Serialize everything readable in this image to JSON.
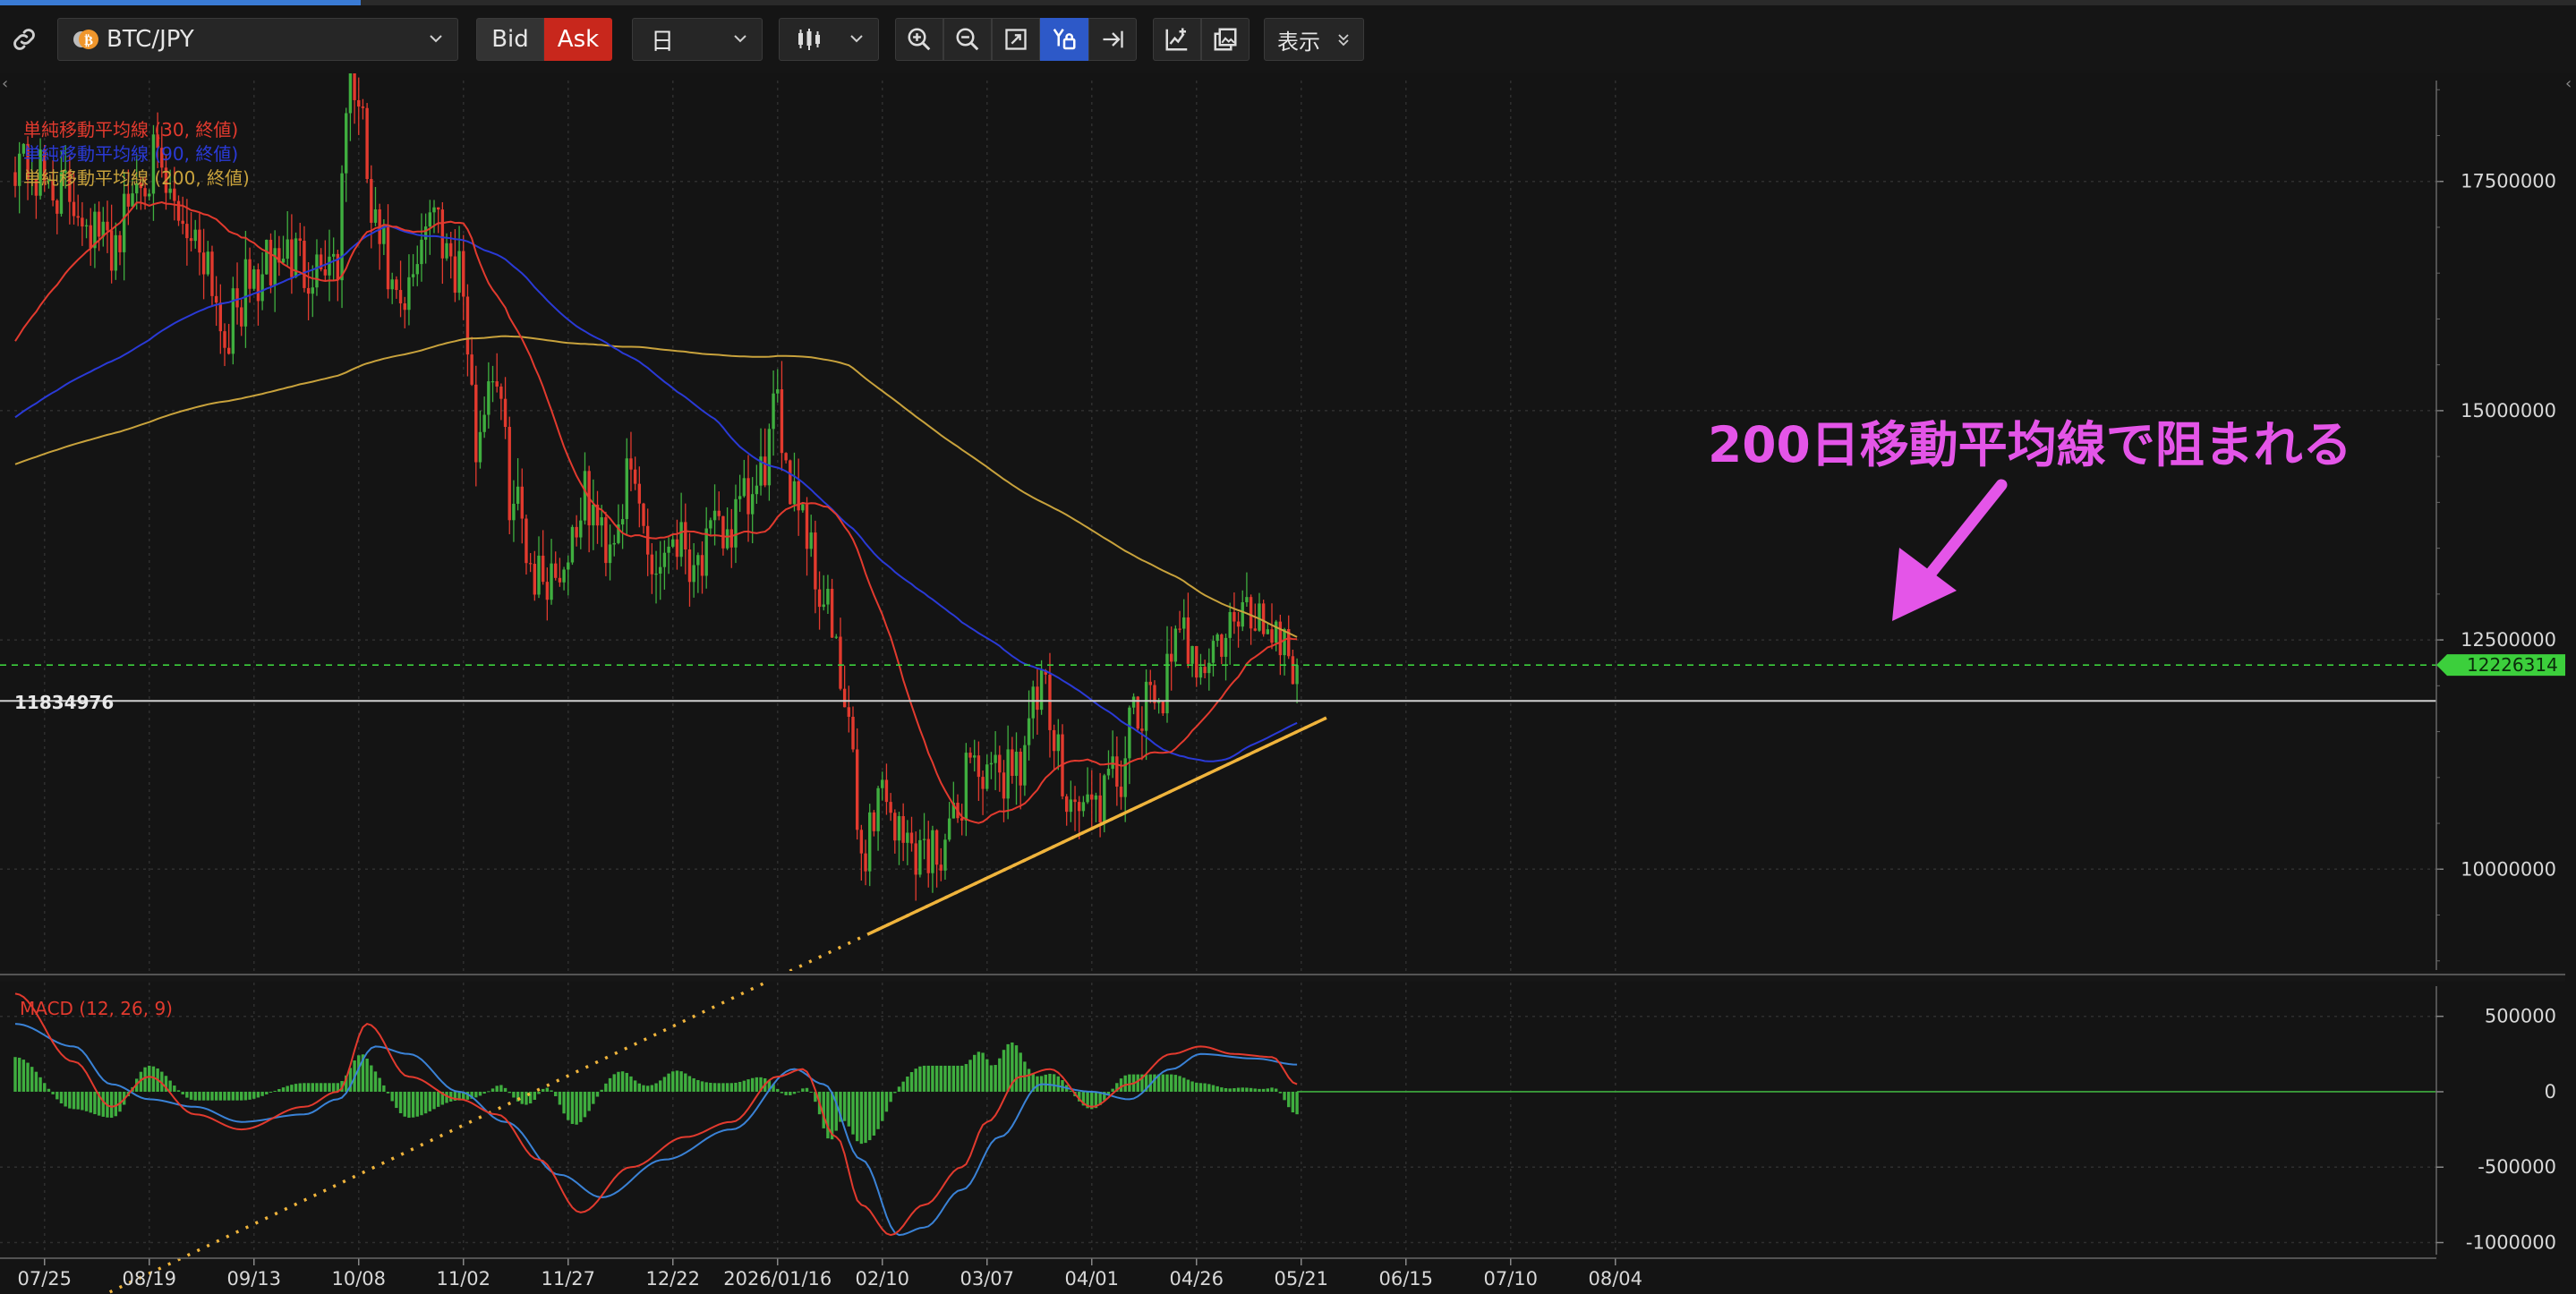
{
  "toolbar": {
    "symbol": "BTC/JPY",
    "bid_label": "Bid",
    "ask_label": "Ask",
    "timeframe": "日",
    "display_label": "表示",
    "page_load_progress": 0.14
  },
  "colors": {
    "background": "#141414",
    "candle_up": "#3fae3f",
    "candle_down": "#e23a2e",
    "sma30": "#e23a2e",
    "sma90": "#2a3ad6",
    "sma200": "#c8a23c",
    "trendline": "#f0b43c",
    "annotation": "#e455e8",
    "current_price_line": "#3ccf3c",
    "ask_active": "#c8271c",
    "tool_active": "#2d59c8"
  },
  "chart_data": {
    "type": "candlestick",
    "price_pane": {
      "y_ticks": [
        10000000,
        12500000,
        15000000,
        17500000
      ],
      "ylim": [
        8900000,
        18600000
      ],
      "legend": [
        {
          "label": "単純移動平均線 (30, 終値)",
          "color": "#e23a2e"
        },
        {
          "label": "単純移動平均線 (90, 終値)",
          "color": "#2a3ad6"
        },
        {
          "label": "単純移動平均線 (200, 終値)",
          "color": "#c8a23c"
        }
      ],
      "horizontal_line_label": "11834976",
      "horizontal_line_value": 11834976,
      "current_price_label": "12226314",
      "current_price_value": 12226314,
      "annotation": "200日移動平均線で阻まれる",
      "trendline": {
        "start_date": "02/07",
        "start_value": 9300000,
        "end_date": "05/27",
        "end_value": 11650000,
        "extend_to": "08/08"
      },
      "anchors": [
        [
          "07/18",
          17800000
        ],
        [
          "07/25",
          17500000
        ],
        [
          "08/01",
          17300000
        ],
        [
          "08/09",
          16800000
        ],
        [
          "08/19",
          17700000
        ],
        [
          "08/25",
          17200000
        ],
        [
          "09/01",
          16800000
        ],
        [
          "09/06",
          15900000
        ],
        [
          "09/13",
          16400000
        ],
        [
          "09/20",
          16700000
        ],
        [
          "09/27",
          16600000
        ],
        [
          "10/03",
          16700000
        ],
        [
          "10/06",
          18900000
        ],
        [
          "10/08",
          18200000
        ],
        [
          "10/12",
          16900000
        ],
        [
          "10/18",
          16000000
        ],
        [
          "10/25",
          17200000
        ],
        [
          "11/01",
          16600000
        ],
        [
          "11/05",
          14700000
        ],
        [
          "11/09",
          15500000
        ],
        [
          "11/14",
          14000000
        ],
        [
          "11/20",
          13200000
        ],
        [
          "11/25",
          13300000
        ],
        [
          "12/01",
          14000000
        ],
        [
          "12/06",
          13600000
        ],
        [
          "12/12",
          14200000
        ],
        [
          "12/18",
          13300000
        ],
        [
          "12/22",
          13700000
        ],
        [
          "12/28",
          13400000
        ],
        [
          "01/04",
          13700000
        ],
        [
          "01/10",
          14000000
        ],
        [
          "01/16",
          14900000
        ],
        [
          "01/20",
          14200000
        ],
        [
          "01/27",
          13000000
        ],
        [
          "02/01",
          11800000
        ],
        [
          "02/05",
          10200000
        ],
        [
          "02/10",
          10900000
        ],
        [
          "02/15",
          10300000
        ],
        [
          "02/21",
          10200000
        ],
        [
          "02/27",
          10400000
        ],
        [
          "03/03",
          11300000
        ],
        [
          "03/07",
          10900000
        ],
        [
          "03/14",
          11200000
        ],
        [
          "03/20",
          11900000
        ],
        [
          "03/24",
          11200000
        ],
        [
          "03/28",
          10700000
        ],
        [
          "04/01",
          10700000
        ],
        [
          "04/06",
          10900000
        ],
        [
          "04/12",
          11600000
        ],
        [
          "04/18",
          12000000
        ],
        [
          "04/23",
          12500000
        ],
        [
          "04/29",
          12300000
        ],
        [
          "05/04",
          12600000
        ],
        [
          "05/10",
          12800000
        ],
        [
          "05/16",
          12600000
        ],
        [
          "05/20",
          12226314
        ]
      ]
    },
    "macd_pane": {
      "title": "MACD (12, 26, 9)",
      "y_ticks": [
        500000,
        0,
        -500000,
        -1000000
      ],
      "ylim": [
        -1080000,
        700000
      ],
      "macd": [
        [
          "07/18",
          650000
        ],
        [
          "08/01",
          200000
        ],
        [
          "08/10",
          -100000
        ],
        [
          "08/19",
          100000
        ],
        [
          "08/30",
          -150000
        ],
        [
          "09/10",
          -250000
        ],
        [
          "09/25",
          -100000
        ],
        [
          "10/03",
          0
        ],
        [
          "10/10",
          450000
        ],
        [
          "10/20",
          100000
        ],
        [
          "11/01",
          -50000
        ],
        [
          "11/10",
          -150000
        ],
        [
          "11/20",
          -450000
        ],
        [
          "11/30",
          -800000
        ],
        [
          "12/12",
          -500000
        ],
        [
          "12/25",
          -300000
        ],
        [
          "01/05",
          -200000
        ],
        [
          "01/16",
          100000
        ],
        [
          "01/22",
          150000
        ],
        [
          "01/30",
          -300000
        ],
        [
          "02/05",
          -750000
        ],
        [
          "02/12",
          -950000
        ],
        [
          "02/20",
          -750000
        ],
        [
          "03/01",
          -500000
        ],
        [
          "03/07",
          -200000
        ],
        [
          "03/15",
          100000
        ],
        [
          "03/22",
          150000
        ],
        [
          "04/01",
          -100000
        ],
        [
          "04/10",
          50000
        ],
        [
          "04/20",
          250000
        ],
        [
          "04/27",
          300000
        ],
        [
          "05/05",
          250000
        ],
        [
          "05/14",
          230000
        ],
        [
          "05/20",
          50000
        ]
      ],
      "signal": [
        [
          "07/18",
          450000
        ],
        [
          "08/01",
          300000
        ],
        [
          "08/10",
          50000
        ],
        [
          "08/19",
          -50000
        ],
        [
          "08/30",
          -100000
        ],
        [
          "09/10",
          -200000
        ],
        [
          "09/25",
          -150000
        ],
        [
          "10/03",
          -50000
        ],
        [
          "10/12",
          300000
        ],
        [
          "10/20",
          250000
        ],
        [
          "11/01",
          0
        ],
        [
          "11/12",
          -200000
        ],
        [
          "11/25",
          -550000
        ],
        [
          "12/05",
          -700000
        ],
        [
          "12/20",
          -450000
        ],
        [
          "01/05",
          -250000
        ],
        [
          "01/20",
          150000
        ],
        [
          "01/27",
          50000
        ],
        [
          "02/05",
          -450000
        ],
        [
          "02/14",
          -950000
        ],
        [
          "02/20",
          -900000
        ],
        [
          "03/01",
          -650000
        ],
        [
          "03/10",
          -300000
        ],
        [
          "03/20",
          50000
        ],
        [
          "04/01",
          0
        ],
        [
          "04/10",
          -50000
        ],
        [
          "04/20",
          150000
        ],
        [
          "04/27",
          250000
        ],
        [
          "05/10",
          220000
        ],
        [
          "05/20",
          180000
        ]
      ]
    },
    "x_ticks": [
      "07/25",
      "08/19",
      "09/13",
      "10/08",
      "11/02",
      "11/27",
      "12/22",
      "2026/01/16",
      "02/10",
      "03/07",
      "04/01",
      "04/26",
      "05/21",
      "06/15",
      "07/10",
      "08/04"
    ],
    "x_tick_days": [
      7,
      32,
      57,
      82,
      107,
      132,
      157,
      182,
      207,
      232,
      257,
      282,
      307,
      332,
      357,
      382
    ]
  }
}
